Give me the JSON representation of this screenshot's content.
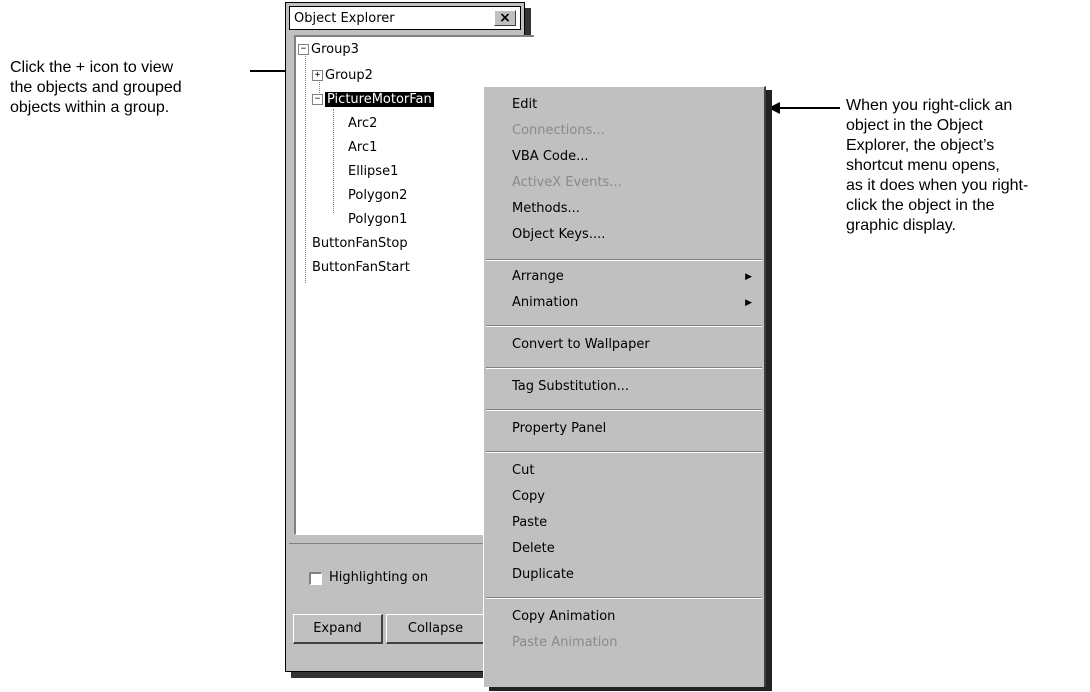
{
  "callout_left": {
    "line1": "Click the + icon to view",
    "line2": "the objects and grouped",
    "line3": "objects within a group."
  },
  "callout_right": {
    "line1": "When you right-click an",
    "line2": "object in the Object",
    "line3": "Explorer, the object’s",
    "line4": "shortcut menu opens,",
    "line5": "as it does when you right-",
    "line6": "click the object in the",
    "line7": "graphic display."
  },
  "window": {
    "title": "Object Explorer",
    "close": "×"
  },
  "tree": {
    "group3": "Group3",
    "group2": "Group2",
    "picture": "PictureMotorFan",
    "arc2": "Arc2",
    "arc1": "Arc1",
    "ellipse1": "Ellipse1",
    "polygon2": "Polygon2",
    "polygon1": "Polygon1",
    "stop": "ButtonFanStop",
    "start": "ButtonFanStart",
    "minus": "−",
    "plus": "+"
  },
  "bottom": {
    "highlight_label": "Highlighting on",
    "expand": "Expand",
    "collapse": "Collapse"
  },
  "menu": {
    "edit": "Edit",
    "connections": "Connections...",
    "vba": "VBA Code...",
    "activex": "ActiveX Events...",
    "methods": "Methods...",
    "keys": "Object Keys....",
    "arrange": "Arrange",
    "animation": "Animation",
    "wallpaper": "Convert to Wallpaper",
    "tagsub": "Tag Substitution...",
    "property": "Property Panel",
    "cut": "Cut",
    "copy": "Copy",
    "paste": "Paste",
    "delete": "Delete",
    "duplicate": "Duplicate",
    "copy_anim": "Copy Animation",
    "paste_anim": "Paste Animation",
    "submenu_arrow": "▶"
  }
}
